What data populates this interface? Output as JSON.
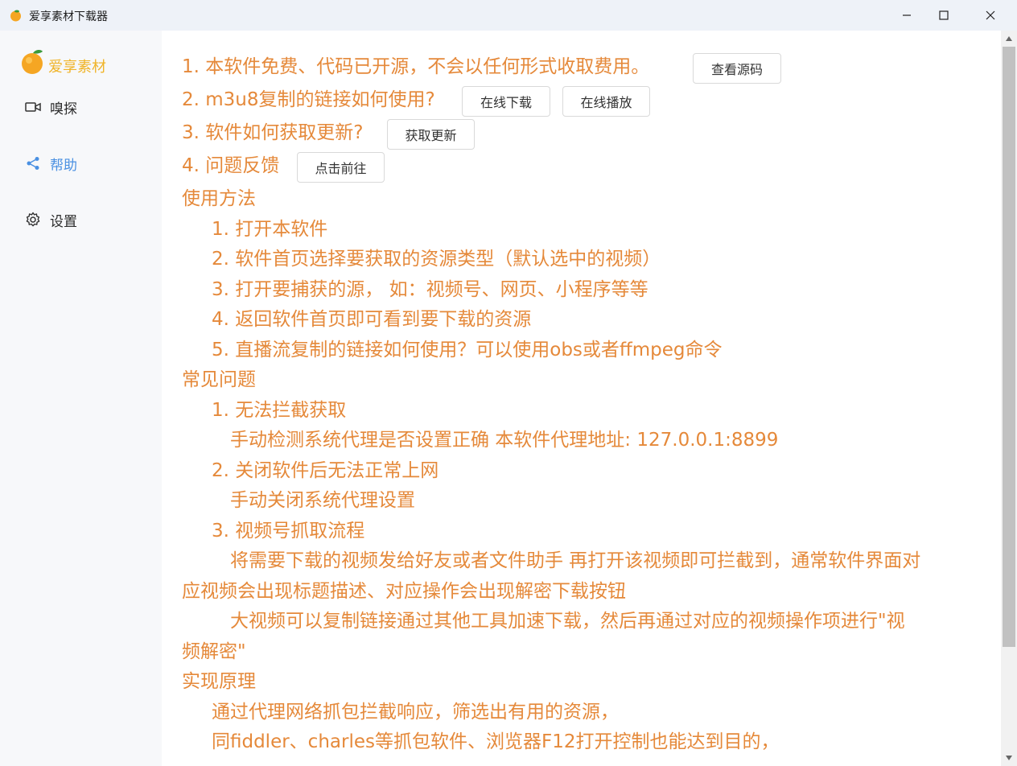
{
  "window": {
    "title": "爱享素材下载器"
  },
  "sidebar": {
    "logo_text": "爱享素材",
    "items": [
      {
        "label": "嗅探",
        "icon": "video-camera-icon"
      },
      {
        "label": "帮助",
        "icon": "share-icon"
      },
      {
        "label": "设置",
        "icon": "gear-icon"
      }
    ]
  },
  "content": {
    "line1": "1. 本软件免费、代码已开源，不会以任何形式收取费用。",
    "btn_source": "查看源码",
    "line2": "2. m3u8复制的链接如何使用?",
    "btn_online_download": "在线下载",
    "btn_online_play": "在线播放",
    "line3": "3. 软件如何获取更新?",
    "btn_update": "获取更新",
    "line4": "4. 问题反馈",
    "btn_goto": "点击前往",
    "usage_title": "使用方法",
    "usage": [
      "1. 打开本软件",
      "2. 软件首页选择要获取的资源类型（默认选中的视频）",
      "3. 打开要捕获的源， 如：视频号、网页、小程序等等",
      "4. 返回软件首页即可看到要下载的资源",
      "5. 直播流复制的链接如何使用？可以使用obs或者ffmpeg命令"
    ],
    "faq_title": "常见问题",
    "faq1_q": "1. 无法拦截获取",
    "faq1_a": "手动检测系统代理是否设置正确 本软件代理地址: 127.0.0.1:8899",
    "faq2_q": "2. 关闭软件后无法正常上网",
    "faq2_a": "手动关闭系统代理设置",
    "faq3_q": "3. 视频号抓取流程",
    "faq3_a1_l1": "将需要下载的视频发给好友或者文件助手 再打开该视频即可拦截到，通常软件界面对",
    "faq3_a1_l2": "应视频会出现标题描述、对应操作会出现解密下载按钮",
    "faq3_a2_l1": "大视频可以复制链接通过其他工具加速下载，然后再通过对应的视频操作项进行\"视",
    "faq3_a2_l2": "频解密\"",
    "principle_title": "实现原理",
    "principle_1": "通过代理网络抓包拦截响应，筛选出有用的资源，",
    "principle_2": "同fiddler、charles等抓包软件、浏览器F12打开控制也能达到目的，"
  },
  "colors": {
    "accent_orange": "#e5893a",
    "active_blue": "#4a90e2",
    "logo_yellow": "#f0b429"
  }
}
